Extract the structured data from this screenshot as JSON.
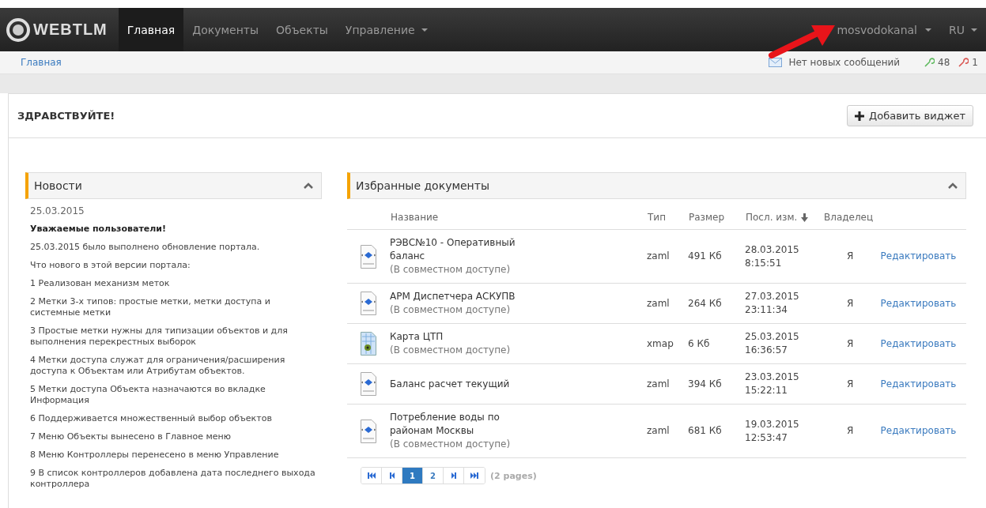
{
  "navbar": {
    "logo": "WEBTLM",
    "items": [
      {
        "label": "Главная",
        "selected": true,
        "dropdown": false
      },
      {
        "label": "Документы",
        "selected": false,
        "dropdown": false
      },
      {
        "label": "Объекты",
        "selected": false,
        "dropdown": false
      },
      {
        "label": "Управление",
        "selected": false,
        "dropdown": true
      }
    ],
    "user": "mosvodokanal",
    "language": "RU"
  },
  "breadcrumb": "Главная",
  "status": {
    "messages": "Нет новых сообщений",
    "ok_count": "48",
    "error_count": "1"
  },
  "page_title": "ЗДРАВСТВУЙТЕ!",
  "add_widget_button": "Добавить виджет",
  "news": {
    "title": "Новости",
    "date": "25.03.2015",
    "paragraphs": [
      {
        "text": "Уважаемые пользователи!",
        "kind": "heading"
      },
      {
        "text": "25.03.2015 было выполнено обновление портала.",
        "kind": "text"
      },
      {
        "text": "Что нового в этой версии портала:",
        "kind": "text"
      },
      {
        "text": "1 Реализован механизм меток",
        "kind": "text"
      },
      {
        "text": "2 Метки 3-х типов: простые метки, метки доступа и системные метки",
        "kind": "text"
      },
      {
        "text": "3 Простые метки нужны для типизации объектов и для выполнения перекрестных выборок",
        "kind": "text"
      },
      {
        "text": "4 Метки доступа служат для ограничения/расширения доступа к Объектам или Атрибутам объектов.",
        "kind": "text"
      },
      {
        "text": "5 Метки доступа Объекта назначаются во вкладке Информация",
        "kind": "text"
      },
      {
        "text": "6 Поддерживается множественный выбор объектов",
        "kind": "text"
      },
      {
        "text": "7 Меню Объекты вынесено в Главное меню",
        "kind": "text"
      },
      {
        "text": "8 Меню Контроллеры перенесено в меню Управление",
        "kind": "text"
      },
      {
        "text": "9 В список контроллеров добавлена дата последнего выхода контроллера",
        "kind": "text"
      }
    ]
  },
  "favorites": {
    "title": "Избранные документы",
    "columns": [
      {
        "label": "Название",
        "sorted": false
      },
      {
        "label": "Тип",
        "sorted": false
      },
      {
        "label": "Размер",
        "sorted": false
      },
      {
        "label": "Посл. изм.",
        "sorted": true
      },
      {
        "label": "Владелец",
        "sorted": false
      }
    ],
    "rows": [
      {
        "kind": "xaml",
        "name": "РЭВС№10 - Оперативный баланс",
        "shared": "(В совместном доступе)",
        "type": "zaml",
        "size": "491 Кб",
        "date": "28.03.2015",
        "time": "8:15:51",
        "owner": "Я",
        "action": "Редактировать"
      },
      {
        "kind": "xaml",
        "name": "АРМ Диспетчера АСКУПВ",
        "shared": "(В совместном доступе)",
        "type": "zaml",
        "size": "264 Кб",
        "date": "27.03.2015",
        "time": "23:11:34",
        "owner": "Я",
        "action": "Редактировать"
      },
      {
        "kind": "map",
        "name": "Карта ЦТП",
        "shared": "(В совместном доступе)",
        "type": "xmap",
        "size": "6 Кб",
        "date": "25.03.2015",
        "time": "16:36:57",
        "owner": "Я",
        "action": "Редактировать"
      },
      {
        "kind": "xaml",
        "name": "Баланс расчет текущий",
        "type": "zaml",
        "size": "394 Кб",
        "date": "23.03.2015",
        "time": "15:22:11",
        "owner": "Я",
        "action": "Редактировать"
      },
      {
        "kind": "xaml",
        "name": "Потребление воды по районам Москвы",
        "shared": "(В совместном доступе)",
        "type": "zaml",
        "size": "681 Кб",
        "date": "19.03.2015",
        "time": "12:53:47",
        "owner": "Я",
        "action": "Редактировать"
      }
    ],
    "pager": {
      "pages": [
        {
          "label": "1",
          "selected": true
        },
        {
          "label": "2",
          "selected": false
        }
      ],
      "summary": "(2 pages)"
    }
  }
}
